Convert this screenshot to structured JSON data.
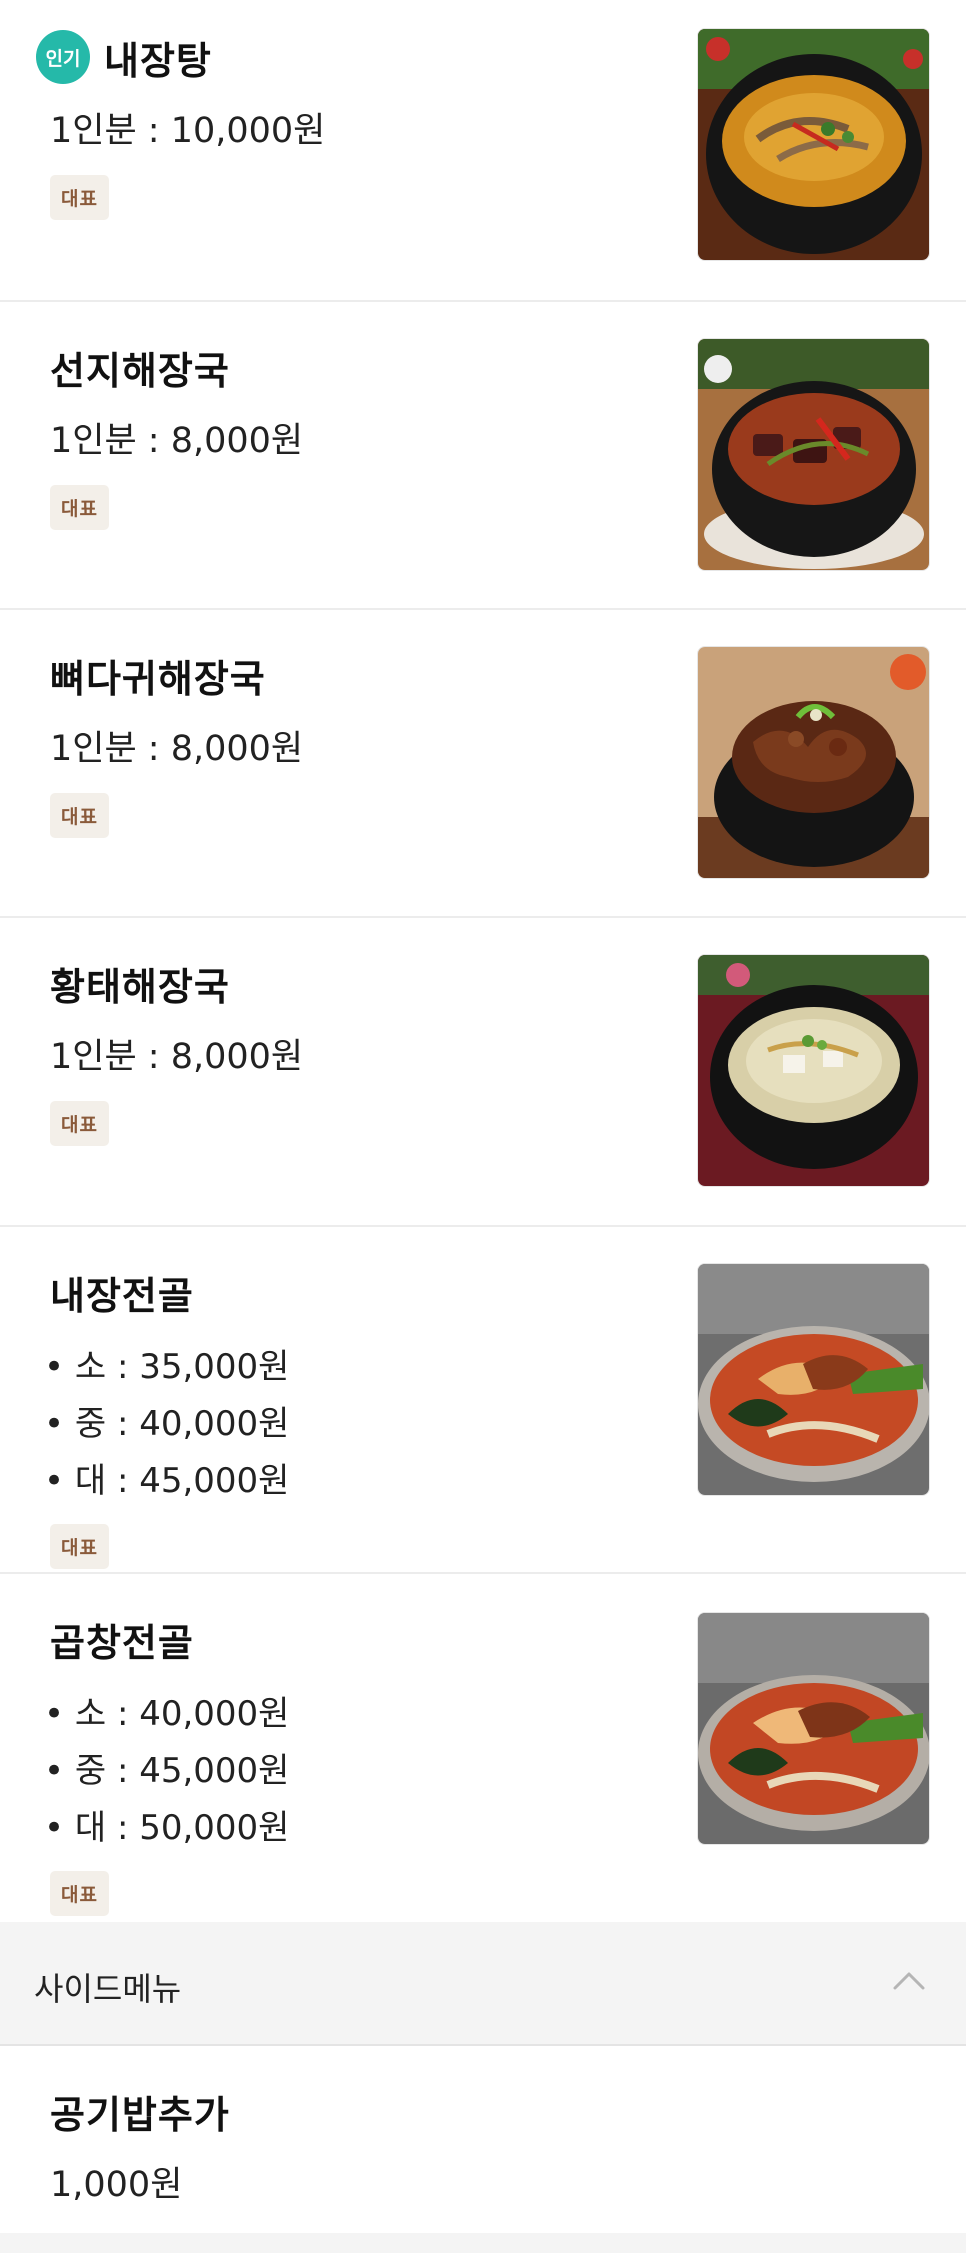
{
  "menu_items": [
    {
      "popular_badge": "인기",
      "name": "내장탕",
      "price": "1인분 : 10,000원",
      "tag": "대표",
      "image": "naejangtang-photo"
    },
    {
      "name": "선지해장국",
      "price": "1인분 : 8,000원",
      "tag": "대표",
      "image": "seonji-haejangguk-photo"
    },
    {
      "name": "뼈다귀해장국",
      "price": "1인분 : 8,000원",
      "tag": "대표",
      "image": "ppyeodagwi-haejangguk-photo"
    },
    {
      "name": "황태해장국",
      "price": "1인분 : 8,000원",
      "tag": "대표",
      "image": "hwangtae-haejangguk-photo"
    },
    {
      "name": "내장전골",
      "prices": [
        "• 소 : 35,000원",
        "• 중 : 40,000원",
        "• 대 : 45,000원"
      ],
      "tag": "대표",
      "image": "naejang-jeongol-photo"
    },
    {
      "name": "곱창전골",
      "prices": [
        "• 소 : 40,000원",
        "• 중 : 45,000원",
        "• 대 : 50,000원"
      ],
      "tag": "대표",
      "image": "gopchang-jeongol-photo"
    }
  ],
  "side_menu": {
    "title": "사이드메뉴",
    "toggle_icon": "chevron-up-icon",
    "items": [
      {
        "name": "공기밥추가",
        "price": "1,000원"
      }
    ]
  },
  "colors": {
    "popular_badge": "#25b9a9",
    "tag_bg": "#f3efe9",
    "tag_text": "#8a5a3a",
    "section_bg": "#f4f4f4"
  }
}
